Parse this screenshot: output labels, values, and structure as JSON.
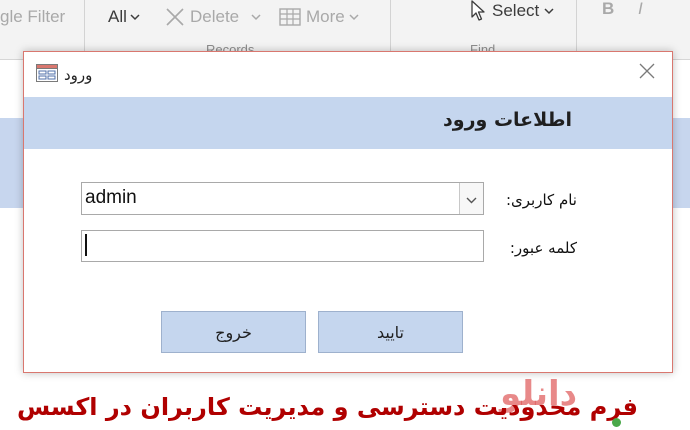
{
  "ribbon": {
    "toggle_filter_label": "gle Filter",
    "all_label": "All",
    "delete_label": "Delete",
    "more_label": "More",
    "select_label": "Select",
    "records_group": "Records",
    "find_group": "Find",
    "bold_label": "B",
    "italic_label": "I"
  },
  "dialog": {
    "window_title": "ورود",
    "header_title": "اطلاعات ورود",
    "username_label": "نام کاربری:",
    "username_value": "admin",
    "password_label": "کلمه عبور:",
    "password_value": "",
    "ok_label": "تایید",
    "exit_label": "خروج"
  },
  "caption": {
    "text": "فرم محدودیت دسترسی و مدیریت کاربران در اکسس",
    "watermark": "دانلو"
  },
  "colors": {
    "header_band": "#c5d6ee",
    "button_bg": "#c5d6ee",
    "dialog_border": "#d9776f",
    "caption": "#b00000"
  }
}
